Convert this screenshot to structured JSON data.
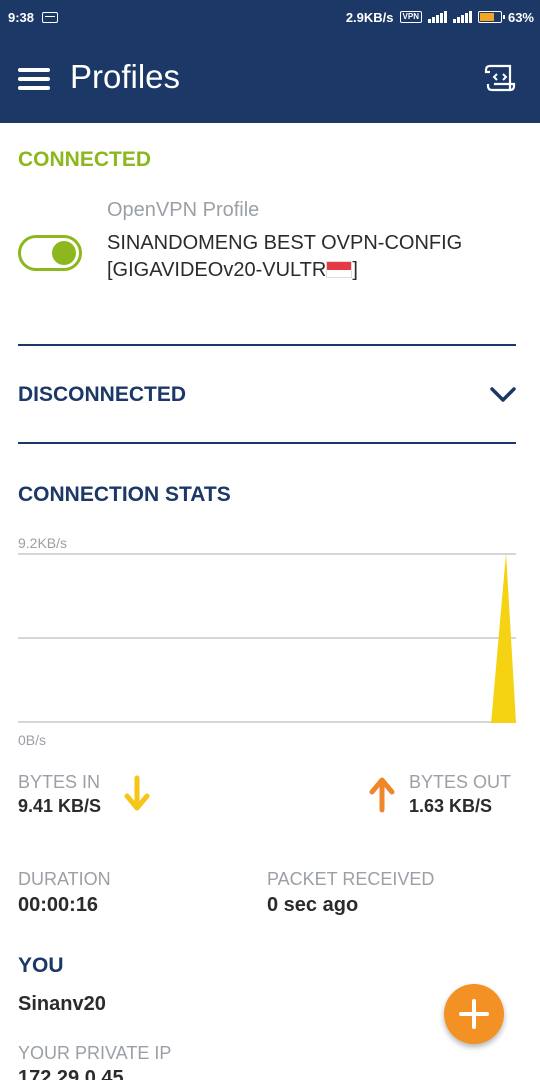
{
  "status_bar": {
    "time": "9:38",
    "net_speed": "2.9KB/s",
    "vpn_label": "VPN",
    "battery": "63%"
  },
  "app_bar": {
    "title": "Profiles"
  },
  "connected": {
    "heading": "CONNECTED",
    "profile_type": "OpenVPN Profile",
    "profile_name": "SINANDOMENG BEST OVPN-CONFIG [GIGAVIDEOv20-VULTR",
    "profile_name_end": "]",
    "toggle_on": true
  },
  "disconnected": {
    "heading": "DISCONNECTED"
  },
  "stats": {
    "heading": "CONNECTION STATS",
    "y_max_label": "9.2KB/s",
    "y_min_label": "0B/s",
    "bytes_in_label": "BYTES IN",
    "bytes_in_value": "9.41 KB/S",
    "bytes_out_label": "BYTES OUT",
    "bytes_out_value": "1.63 KB/S",
    "duration_label": "DURATION",
    "duration_value": "00:00:16",
    "packet_label": "PACKET RECEIVED",
    "packet_value": "0 sec ago"
  },
  "chart_data": {
    "type": "area",
    "ylim": [
      0,
      9.2
    ],
    "ylabel_max": "9.2KB/s",
    "ylabel_min": "0B/s",
    "x": [
      0,
      0.95,
      0.98,
      1.0
    ],
    "series": [
      {
        "values": [
          0,
          0,
          9.2,
          0
        ],
        "color": "#f5d312"
      }
    ],
    "grid": true
  },
  "you": {
    "heading": "YOU",
    "name": "Sinanv20",
    "private_ip_label": "YOUR PRIVATE IP",
    "private_ip_value": "172.29.0.45"
  },
  "colors": {
    "primary": "#1b3866",
    "connected_green": "#8cb81e",
    "fab_orange": "#f39124",
    "in_arrow": "#f5c518",
    "out_arrow": "#f0862a"
  },
  "icons": {
    "menu": "hamburger-icon",
    "import": "import-profile-icon",
    "chevron": "chevron-down-icon",
    "in": "arrow-down-icon",
    "out": "arrow-up-icon",
    "fab": "plus-icon"
  }
}
